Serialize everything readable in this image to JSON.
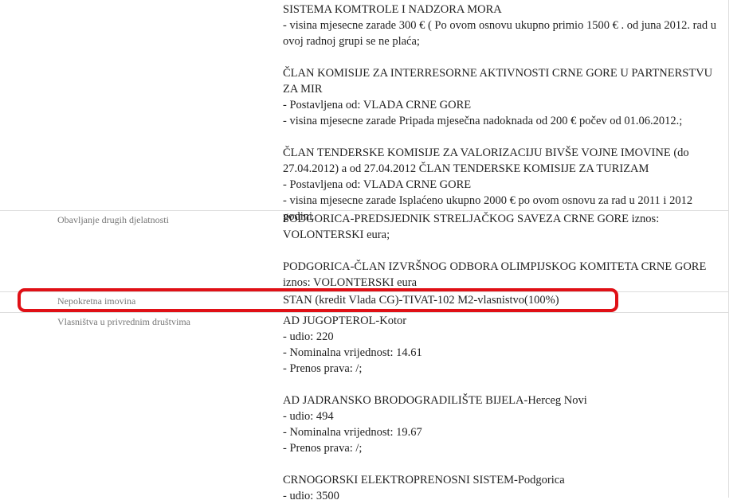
{
  "prev": {
    "lines": [
      "SISTEMA KOMTROLE I NADZORA MORA",
      "- visina mjesecne zarade 300 € ( Po ovom osnovu ukupno primio 1500 € . od juna 2012. rad u ovoj radnoj grupi se ne plaća;",
      "",
      "ČLAN KOMISIJE ZA INTERRESORNE AKTIVNOSTI CRNE GORE U PARTNERSTVU ZA MIR",
      "- Postavljena od: VLADA CRNE GORE",
      "- visina mjesecne zarade Pripada mjesečna nadoknada od 200 € počev od 01.06.2012.;",
      "",
      "ČLAN TENDERSKE KOMISIJE ZA VALORIZACIJU BIVŠE VOJNE IMOVINE (do 27.04.2012) a od 27.04.2012 ČLAN TENDERSKE KOMISIJE ZA TURIZAM",
      "- Postavljena od: VLADA CRNE GORE",
      "- visina mjesecne zarade Isplaćeno ukupno 2000 € po ovom osnovu za rad u 2011 i 2012 godini"
    ]
  },
  "drugi": {
    "label": "Obavljanje drugih djelatnosti",
    "lines": [
      "PODGORICA-PREDSJEDNIK STRELJAČKOG SAVEZA CRNE GORE iznos: VOLONTERSKI eura;",
      "",
      "PODGORICA-ČLAN IZVRŠNOG ODBORA OLIMPIJSKOG KOMITETA CRNE GORE iznos: VOLONTERSKI eura"
    ]
  },
  "nepokretna": {
    "label": "Nepokretna imovina",
    "lines": [
      "STAN (kredit Vlada CG)-TIVAT-102 M2-vlasnistvo(100%)"
    ]
  },
  "vlasnistva": {
    "label": "Vlasništva u privrednim društvima",
    "lines": [
      "AD JUGOPTEROL-Kotor",
      "- udio: 220",
      "- Nominalna vrijednost: 14.61",
      "- Prenos prava: /;",
      "",
      "AD JADRANSKO BRODOGRADILIŠTE BIJELA-Herceg Novi",
      "- udio: 494",
      "- Nominalna vrijednost: 19.67",
      "- Prenos prava: /;",
      "",
      "CRNOGORSKI ELEKTROPRENOSNI SISTEM-Podgorica",
      "- udio: 3500"
    ]
  }
}
